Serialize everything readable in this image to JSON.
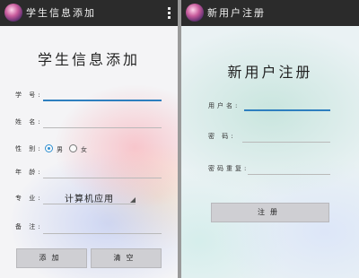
{
  "left": {
    "app_title": "学生信息添加",
    "heading": "学生信息添加",
    "labels": {
      "student_id": "学 号:",
      "name": "姓 名:",
      "gender": "性 别:",
      "age": "年 龄:",
      "major": "专 业:",
      "note": "备 注:"
    },
    "gender_options": {
      "male": "男",
      "female": "女",
      "selected": "男"
    },
    "major_value": "计算机应用",
    "add_button": "添加",
    "clear_button": "清空"
  },
  "right": {
    "app_title": "新用户注册",
    "heading": "新用户注册",
    "labels": {
      "username": "用户名:",
      "password": "密 码:",
      "confirm_password": "密码重复:"
    },
    "register_button": "注册"
  },
  "colors": {
    "titlebar": "#2b2b2b",
    "accent": "#2e7fbf",
    "button": "#cfcfd3"
  }
}
